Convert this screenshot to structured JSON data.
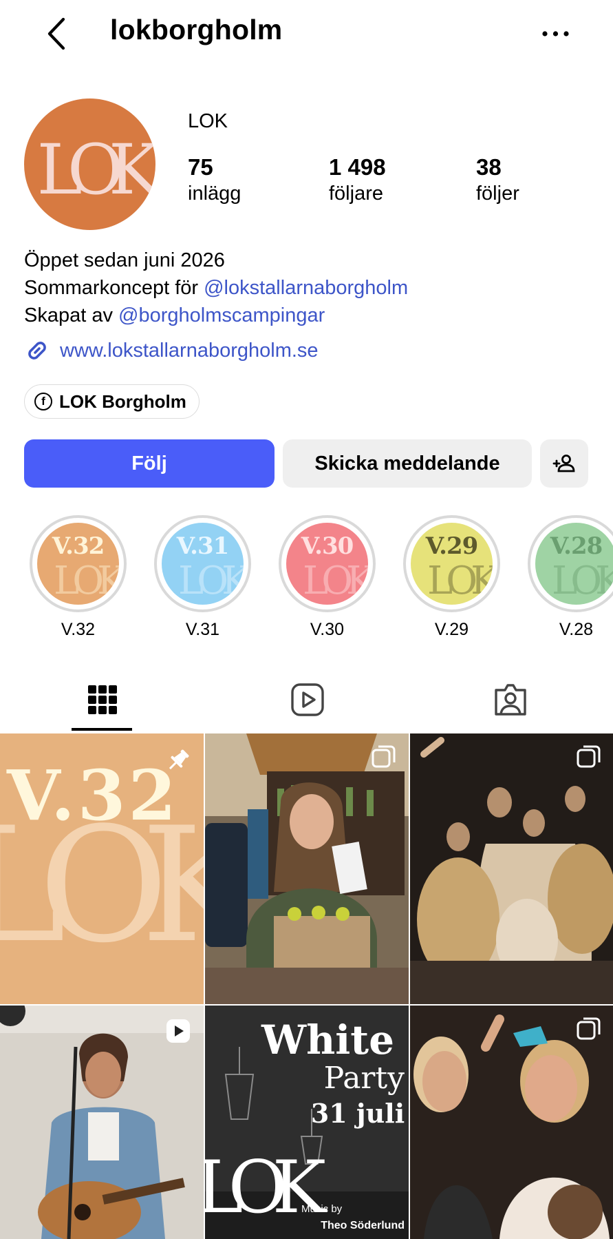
{
  "header": {
    "username": "lokborgholm"
  },
  "profile": {
    "display_name": "LOK",
    "avatar_text": "LOK",
    "stats": [
      {
        "value": "75",
        "label": "inlägg"
      },
      {
        "value": "1 498",
        "label": "följare"
      },
      {
        "value": "38",
        "label": "följer"
      }
    ],
    "bio": {
      "line1": "Öppet sedan juni 2026",
      "line2_prefix": "Sommarkoncept för ",
      "line2_mention": "@lokstallarnaborgholm",
      "line3_prefix": "Skapat av ",
      "line3_mention": "@borgholmscampingar"
    },
    "website": "www.lokstallarnaborgholm.se",
    "facebook_chip": "LOK Borgholm",
    "facebook_icon": "f"
  },
  "actions": {
    "follow_label": "Följ",
    "message_label": "Skicka meddelande"
  },
  "highlights": [
    {
      "label": "V.32",
      "cover_text": "V.32",
      "color": "#e7a972",
      "text_color": "#fff4d8"
    },
    {
      "label": "V.31",
      "cover_text": "V.31",
      "color": "#93d2f4",
      "text_color": "#e9f7ff"
    },
    {
      "label": "V.30",
      "cover_text": "V.30",
      "color": "#f3848a",
      "text_color": "#ffe0e0"
    },
    {
      "label": "V.29",
      "cover_text": "V.29",
      "color": "#e6e27a",
      "text_color": "#5d5a2c"
    },
    {
      "label": "V.28",
      "cover_text": "V.28",
      "color": "#9fd3a4",
      "text_color": "#6a9f70"
    }
  ],
  "highlight_logo": "LOK",
  "posts": {
    "tile1": {
      "big_text": "V.32",
      "logo": "LOK"
    },
    "tile5": {
      "title1": "White",
      "title2": "Party",
      "date": "31 juli",
      "logo": "LOK",
      "music_by": "Music by",
      "artist": "Theo Söderlund"
    }
  },
  "colors": {
    "accent": "#4a5df9",
    "link": "#3d55c8",
    "avatar": "#d77a41",
    "avatar_text": "#f6d8d0"
  }
}
